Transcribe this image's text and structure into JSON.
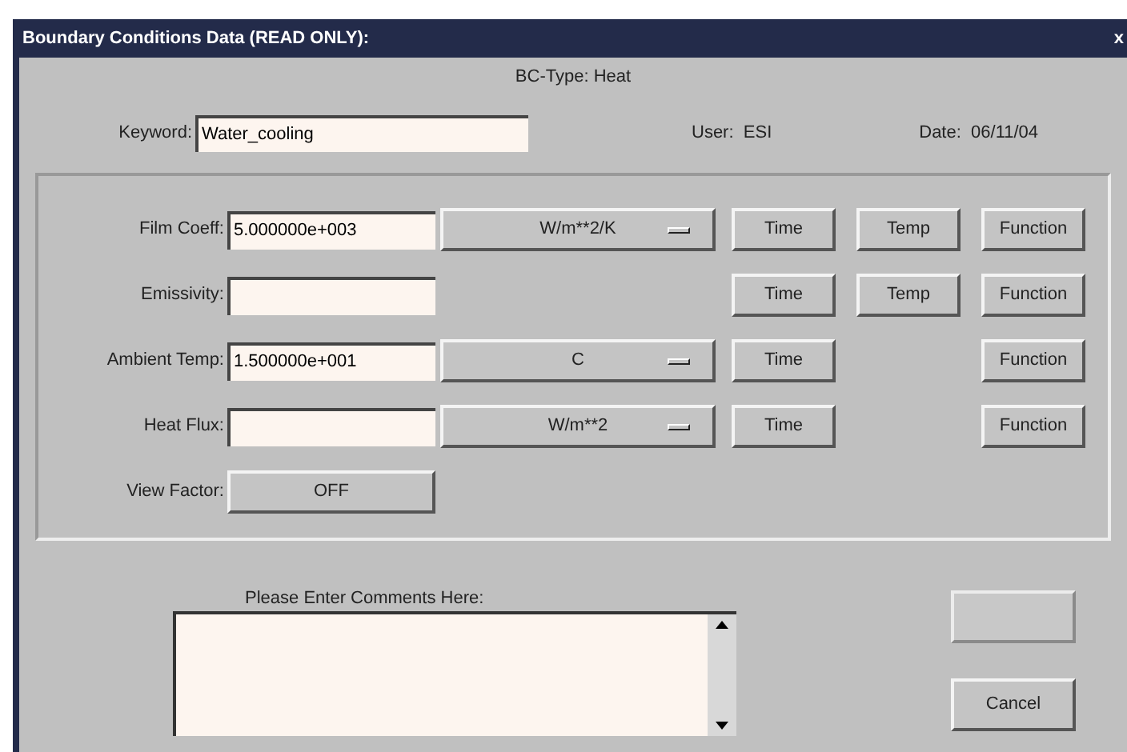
{
  "window": {
    "title": "Boundary Conditions Data (READ ONLY):",
    "close": "x"
  },
  "bc_type": "BC-Type: Heat",
  "keyword": {
    "label": "Keyword:",
    "value": "Water_cooling"
  },
  "user": "User:  ESI",
  "date": "Date:  06/11/04",
  "rows": [
    {
      "kind": "field",
      "label": "Film Coeff:",
      "value": "5.000000e+003",
      "unit": "W/m**2/K",
      "buttons": [
        {
          "kind": "time",
          "label": "Time"
        },
        {
          "kind": "temp",
          "label": "Temp"
        },
        {
          "kind": "function",
          "label": "Function"
        }
      ]
    },
    {
      "kind": "field",
      "label": "Emissivity:",
      "buttons": [
        {
          "kind": "time",
          "label": "Time"
        },
        {
          "kind": "temp",
          "label": "Temp"
        },
        {
          "kind": "function",
          "label": "Function"
        }
      ]
    },
    {
      "kind": "field",
      "label": "Ambient Temp:",
      "value": "1.500000e+001",
      "unit": "C",
      "buttons": [
        {
          "kind": "time",
          "label": "Time"
        },
        {
          "kind": "function",
          "label": "Function"
        }
      ]
    },
    {
      "kind": "field",
      "label": "Heat Flux:",
      "unit": "W/m**2",
      "buttons": [
        {
          "kind": "time",
          "label": "Time"
        },
        {
          "kind": "function",
          "label": "Function"
        }
      ]
    },
    {
      "kind": "toggle",
      "label": "View Factor:",
      "value": "OFF"
    }
  ],
  "comments": {
    "label": "Please Enter Comments Here:"
  },
  "actions": [
    {
      "disabled": true
    },
    {
      "label": "Cancel",
      "disabled": false
    }
  ]
}
